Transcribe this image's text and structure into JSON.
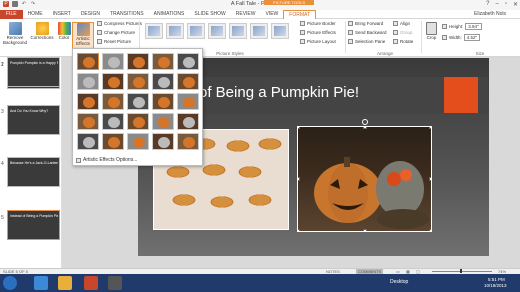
{
  "window": {
    "title": "A Fall Tale - PowerPoint",
    "context_tab_group": "PICTURE TOOLS",
    "user": "Elizabeth Nols"
  },
  "tabs": [
    "FILE",
    "HOME",
    "INSERT",
    "DESIGN",
    "TRANSITIONS",
    "ANIMATIONS",
    "SLIDE SHOW",
    "REVIEW",
    "VIEW",
    "FORMAT"
  ],
  "ribbon": {
    "remove_background": "Remove Background",
    "corrections": "Corrections",
    "color": "Color",
    "artistic_effects": "Artistic Effects",
    "compress": "Compress Pictures",
    "change": "Change Picture",
    "reset": "Reset Picture",
    "adjust_group": "Adjust",
    "styles_group": "Picture Styles",
    "picture_border": "Picture Border",
    "picture_effects": "Picture Effects",
    "picture_layout": "Picture Layout",
    "bring_forward": "Bring Forward",
    "send_backward": "Send Backward",
    "selection_pane": "Selection Pane",
    "align": "Align",
    "group": "Group",
    "rotate": "Rotate",
    "arrange_group": "Arrange",
    "crop": "Crop",
    "height_label": "Height:",
    "height_value": "3.94\"",
    "width_label": "Width:",
    "width_value": "4.52\"",
    "size_group": "Size"
  },
  "dropdown": {
    "options_label": "Artistic Effects Options..."
  },
  "slides": [
    {
      "num": "1",
      "caption": ""
    },
    {
      "num": "2",
      "caption": "Pumpkin Pumpkin is a Happy Pumpkin"
    },
    {
      "num": "3",
      "caption": "And Do You Know Why?"
    },
    {
      "num": "4",
      "caption": "Because He's a Jack-O-Lantern!"
    },
    {
      "num": "5",
      "caption": "Instead of Being a Pumpkin Pie!"
    }
  ],
  "slide": {
    "title": "of Being a Pumpkin Pie!"
  },
  "status": {
    "slide_info": "SLIDE 5 OF 5",
    "notes": "NOTES",
    "comments": "COMMENTS",
    "zoom": "74%"
  },
  "taskbar": {
    "desktop": "Desktop",
    "time": "5:51 PM",
    "date": "10/19/2013"
  },
  "colors": {
    "accent": "#c8462b",
    "context": "#e8903c",
    "slide_orange": "#e34e1c",
    "taskbar": "#1f3a6b"
  }
}
